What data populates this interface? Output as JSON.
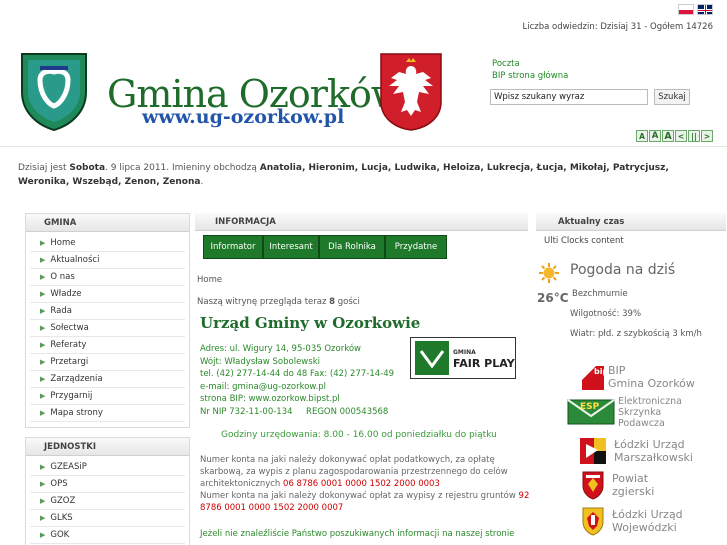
{
  "header": {
    "visits": "Liczba odwiedzin: Dzisiaj 31 - Ogółem 14726",
    "title": "Gmina Ozorków",
    "url": "www.ug-ozorkow.pl",
    "links": [
      "Poczta",
      "BIP strona główna"
    ],
    "search_value": "Wpisz szukany wyraz",
    "search_button": "Szukaj",
    "font_controls": [
      "A",
      "A",
      "A",
      "<",
      "||",
      ">"
    ]
  },
  "today": {
    "prefix": "Dzisiaj jest",
    "day": "Sobota",
    "date": ". 9 lipca 2011. Imieniny obchodzą",
    "names": "Anatolia, Hieronim, Lucja, Ludwika, Heloiza, Lukrecja, Łucja, Mikołaj, Patrycjusz, Weronika, Wszebąd, Zenon, Zenona",
    "suffix": "."
  },
  "sidebar": {
    "gmina_title": "GMINA",
    "gmina_items": [
      "Home",
      "Aktualności",
      "O nas",
      "Władze",
      "Rada",
      "Sołectwa",
      "Referaty",
      "Przetargi",
      "Zarządzenia",
      "Przygarnij",
      "Mapa strony"
    ],
    "jednostki_title": "JEDNOSTKI",
    "jednostki_items": [
      "GZEASiP",
      "OPS",
      "GZOZ",
      "GLKS",
      "GOK"
    ]
  },
  "main": {
    "section_title": "INFORMACJA",
    "tabs": [
      "Informator",
      "Interesant",
      "Dla Rolnika",
      "Przydatne"
    ],
    "breadcrumb": "Home",
    "visitors_pre": "Naszą witrynę przegląda teraz",
    "visitors_count": "8",
    "visitors_post": "gości",
    "office_title": "Urząd Gminy w Ozorkowie",
    "address_lines": [
      "Adres: ul. Wigury 14, 95-035 Ozorków",
      "Wójt: Władysław Sobolewski",
      "tel. (42) 277-14-44 do 48 Fax: (42) 277-14-49",
      "e-mail: gmina@ug-ozorkow.pl",
      "strona BIP: www.ozorkow.bipst.pl",
      "Nr NIP 732-11-00-134     REGON 000543568"
    ],
    "fairplay_gmina": "GMINA",
    "fairplay_text": "FAIR PLAY",
    "hours": "Godziny urzędowania: 8.00 - 16.00 od poniedziałku do piątku",
    "account1_text": "Numer konta na jaki należy dokonywać opłat podatkowych, za opłatę skarbową, za wypis z planu zagospodarowania przestrzennego do celów architektonicznych",
    "account1_number": "06 8786 0001 0000 1502 2000 0003",
    "account2_text": "Numer  konta na jaki należy dokonywać opłat za wypisy z rejestru gruntów",
    "account2_number": "92 8786 0001 0000 1502 2000 0007",
    "notfound": "Jeżeli nie znaleźliście Państwo poszukiwanych informacji na naszej stronie"
  },
  "right": {
    "time_title": "Aktualny czas",
    "ulti": "Ulti Clocks content",
    "weather_title": "Pogoda na dziś",
    "temp": "26°C",
    "condition": "Bezchmurnie",
    "humidity": "Wilgotność: 39%",
    "wind": "Wiatr: płd. z szybkością 3 km/h",
    "links": [
      {
        "line1": "BIP",
        "line2": "Gmina Ozorków"
      },
      {
        "line1": "Elektroniczna",
        "line2": "Skrzynka",
        "line3": "Podawcza"
      },
      {
        "line1": "Łódzki Urząd",
        "line2": "Marszałkowski"
      },
      {
        "line1": "Powiat",
        "line2": "zgierski"
      },
      {
        "line1": "Łódzki Urząd",
        "line2": "Wojewódzki"
      }
    ],
    "bip_icon_label": "bip",
    "esp_icon_label": "ESP"
  },
  "colors": {
    "accent_green": "#1e7a2a",
    "title_green": "#1e6b2a",
    "link_green": "#2a8a2a",
    "url_blue": "#2255aa",
    "account_red": "#cc0000"
  }
}
